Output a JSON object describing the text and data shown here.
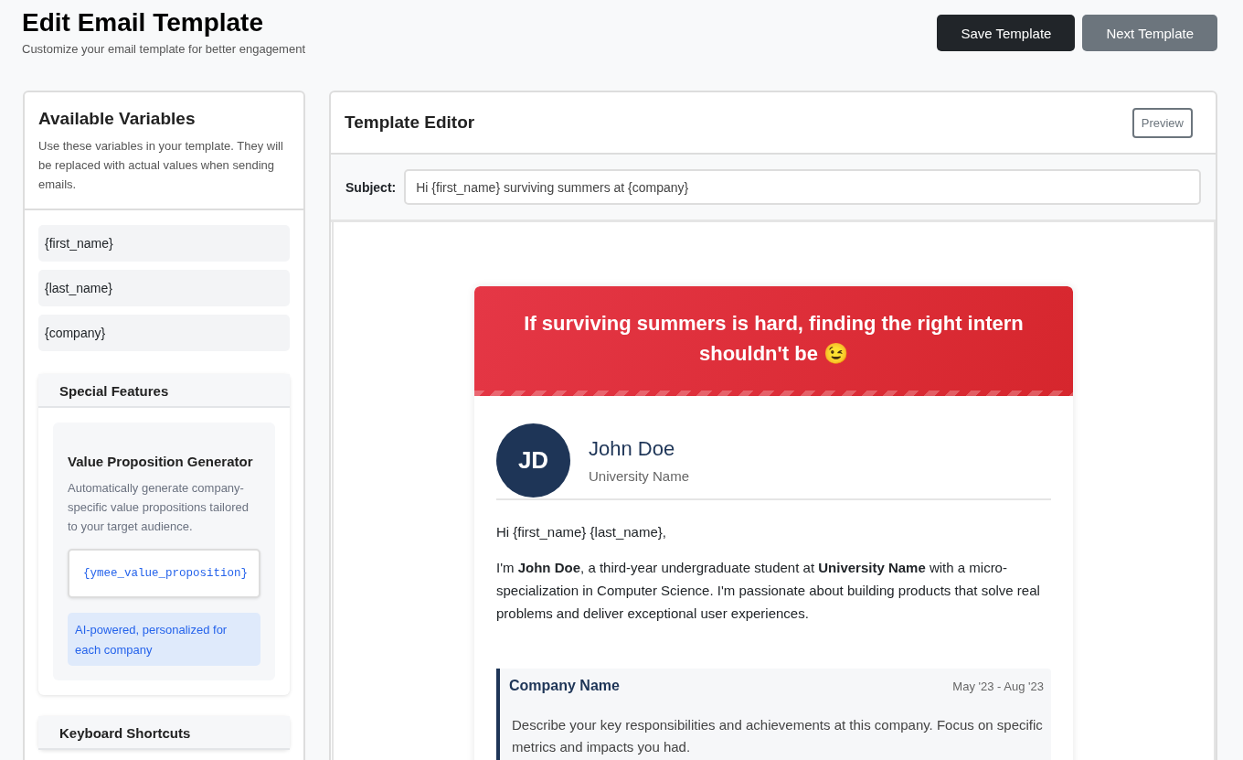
{
  "header": {
    "title": "Edit Email Template",
    "subtitle": "Customize your email template for better engagement",
    "buttons": [
      {
        "label": "Save Template",
        "kind": "primary"
      },
      {
        "label": "Next Template",
        "kind": "secondary"
      }
    ]
  },
  "sidebar": {
    "title": "Available Variables",
    "description": "Use these variables in your template. They will be replaced with actual values when sending emails.",
    "variables": [
      "{first_name}",
      "{last_name}",
      "{company}"
    ],
    "special_features": {
      "title": "Special Features",
      "feature": {
        "title": "Value Proposition Generator",
        "description": "Automatically generate company-specific value propositions tailored to your target audience.",
        "code": "{ymee_value_proposition}",
        "note": "AI-powered, personalized for each company"
      }
    },
    "next_section": {
      "title": "Keyboard Shortcuts"
    }
  },
  "editor": {
    "title": "Template Editor",
    "preview_button": "Preview",
    "subject": {
      "label": "Subject:",
      "value": "Hi {first_name} surviving summers at {company}"
    },
    "email": {
      "headline": "If surviving summers is hard, finding the right intern shouldn't be 😉",
      "profile": {
        "initials": "JD",
        "name": "John Doe",
        "school": "University Name"
      },
      "greeting": "Hi {first_name} {last_name},",
      "intro": "I'm **John Doe**, a third-year undergraduate student at **University Name** with a micro-specialization in Computer Science. I'm passionate about building products that solve real problems and deliver exceptional user experiences.",
      "experience": {
        "company": "Company Name",
        "dates": "May '23 - Aug '23",
        "description": "Describe your key responsibilities and achievements at this company. Focus on specific metrics and impacts you had."
      }
    }
  }
}
